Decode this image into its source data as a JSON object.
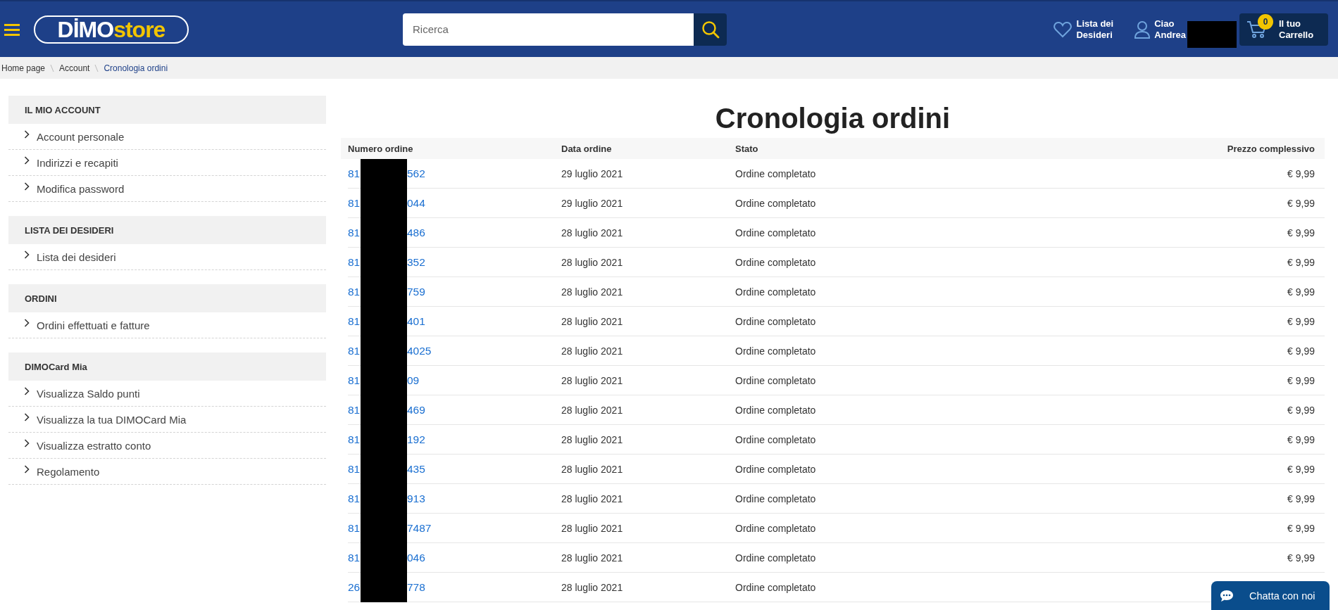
{
  "header": {
    "logo": {
      "part_1": "DİMO",
      "part_2": "store"
    },
    "search": {
      "placeholder": "Ricerca"
    },
    "wishlist": {
      "line_1": "Lista dei",
      "line_2": "Desideri"
    },
    "user": {
      "line_1": "Ciao",
      "line_2": "Andrea"
    },
    "cart": {
      "count": "0",
      "line_1": "Il tuo",
      "line_2": "Carrello"
    }
  },
  "breadcrumb": [
    {
      "label": "Home page",
      "current": false
    },
    {
      "label": "Account",
      "current": false
    },
    {
      "label": "Cronologia ordini",
      "current": true
    }
  ],
  "sidebar": [
    {
      "title": "IL MIO ACCOUNT",
      "items": [
        "Account personale",
        "Indirizzi e recapiti",
        "Modifica password"
      ]
    },
    {
      "title": "LISTA DEI DESIDERI",
      "items": [
        "Lista dei desideri"
      ]
    },
    {
      "title": "ORDINI",
      "items": [
        "Ordini effettuati e fatture"
      ]
    },
    {
      "title": "DIMOCard Mia",
      "items": [
        "Visualizza Saldo punti",
        "Visualizza la tua DIMOCard Mia",
        "Visualizza estratto conto",
        "Regolamento"
      ]
    }
  ],
  "page_title": "Cronologia ordini",
  "table": {
    "columns": [
      "Numero ordine",
      "Data ordine",
      "Stato",
      "Prezzo complessivo"
    ],
    "rows": [
      {
        "number_start": "81",
        "number_end": "562",
        "date": "29 luglio 2021",
        "status": "Ordine completato",
        "price": "€ 9,99"
      },
      {
        "number_start": "81",
        "number_end": "044",
        "date": "29 luglio 2021",
        "status": "Ordine completato",
        "price": "€ 9,99"
      },
      {
        "number_start": "81",
        "number_end": "486",
        "date": "28 luglio 2021",
        "status": "Ordine completato",
        "price": "€ 9,99"
      },
      {
        "number_start": "81",
        "number_end": "352",
        "date": "28 luglio 2021",
        "status": "Ordine completato",
        "price": "€ 9,99"
      },
      {
        "number_start": "81",
        "number_end": "759",
        "date": "28 luglio 2021",
        "status": "Ordine completato",
        "price": "€ 9,99"
      },
      {
        "number_start": "81",
        "number_end": "401",
        "date": "28 luglio 2021",
        "status": "Ordine completato",
        "price": "€ 9,99"
      },
      {
        "number_start": "81",
        "number_end": "4025",
        "date": "28 luglio 2021",
        "status": "Ordine completato",
        "price": "€ 9,99"
      },
      {
        "number_start": "81",
        "number_end": "09",
        "date": "28 luglio 2021",
        "status": "Ordine completato",
        "price": "€ 9,99"
      },
      {
        "number_start": "81",
        "number_end": "469",
        "date": "28 luglio 2021",
        "status": "Ordine completato",
        "price": "€ 9,99"
      },
      {
        "number_start": "81",
        "number_end": "192",
        "date": "28 luglio 2021",
        "status": "Ordine completato",
        "price": "€ 9,99"
      },
      {
        "number_start": "81",
        "number_end": "435",
        "date": "28 luglio 2021",
        "status": "Ordine completato",
        "price": "€ 9,99"
      },
      {
        "number_start": "81",
        "number_end": "913",
        "date": "28 luglio 2021",
        "status": "Ordine completato",
        "price": "€ 9,99"
      },
      {
        "number_start": "81",
        "number_end": "7487",
        "date": "28 luglio 2021",
        "status": "Ordine completato",
        "price": "€ 9,99"
      },
      {
        "number_start": "81",
        "number_end": "046",
        "date": "28 luglio 2021",
        "status": "Ordine completato",
        "price": "€ 9,99"
      },
      {
        "number_start": "26",
        "number_end": "778",
        "date": "28 luglio 2021",
        "status": "Ordine completato"
      }
    ]
  },
  "chat": {
    "label": "Chatta con noi"
  }
}
